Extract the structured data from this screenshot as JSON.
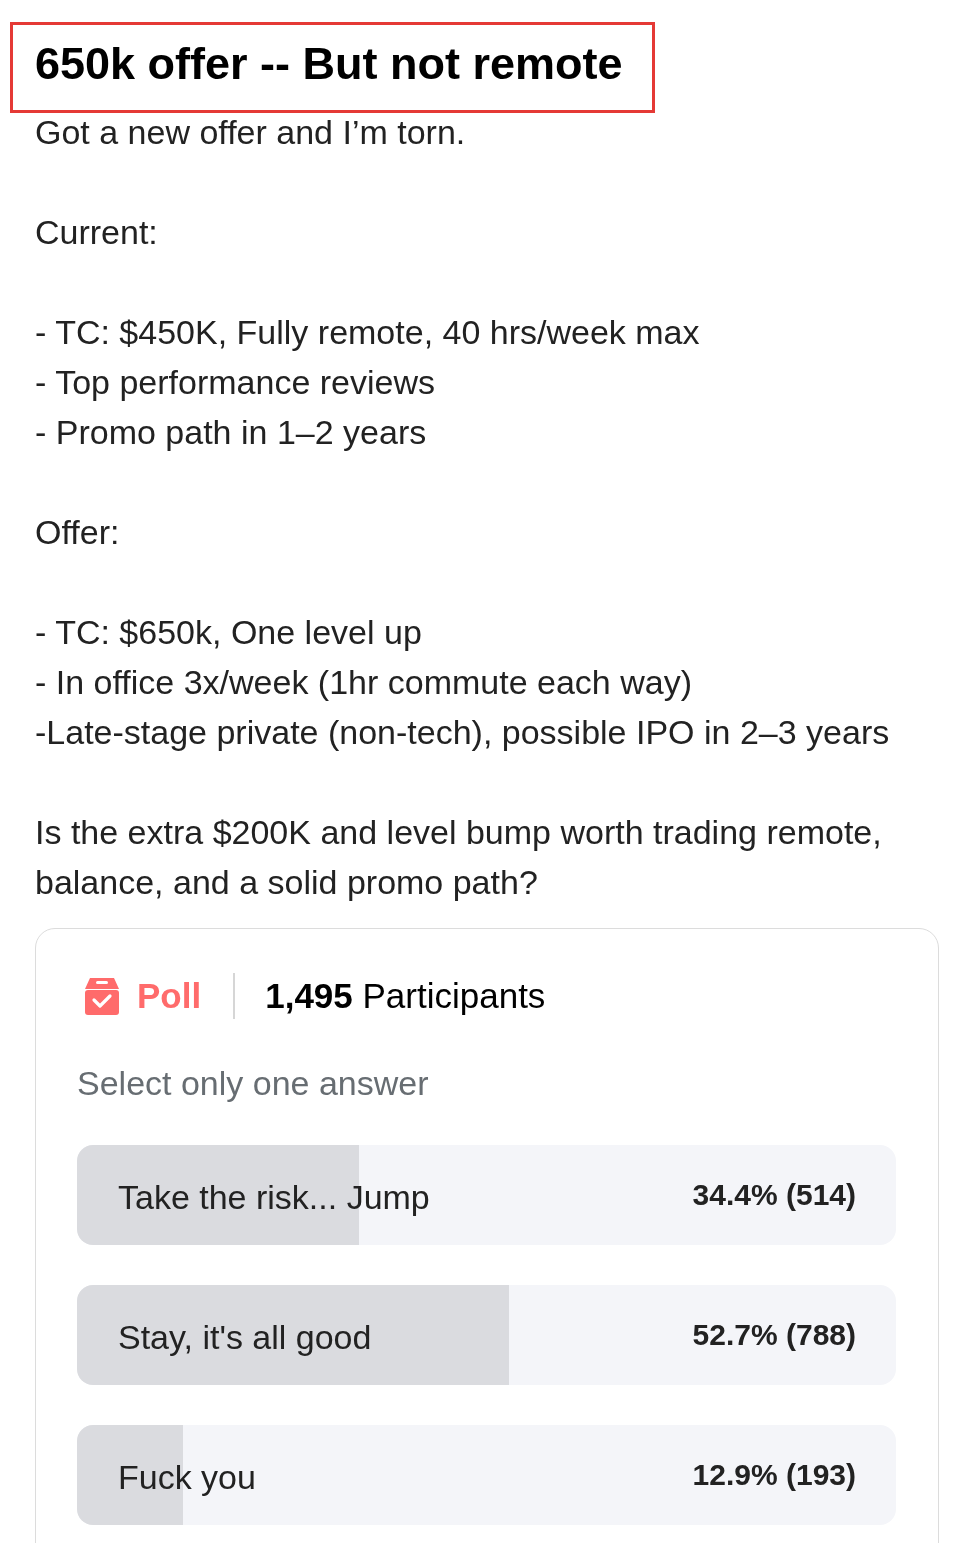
{
  "post": {
    "title": {
      "text": "650k offer -- But not remote",
      "highlighted": true
    },
    "paragraphs": [
      [
        "Got a new offer and I’m torn."
      ],
      [
        "Current:"
      ],
      [
        "- TC: $450K, Fully remote, 40 hrs/week max",
        "- Top performance reviews",
        "- Promo path in 1–2 years"
      ],
      [
        "Offer:"
      ],
      [
        "- TC: $650k, One level up",
        "- In office 3x/week (1hr commute each way)",
        "-Late-stage private (non-tech), possible IPO in 2–3 years"
      ],
      [
        "Is the extra $200K and level bump worth trading remote, balance, and a solid promo path?"
      ]
    ]
  },
  "poll": {
    "label": "Poll",
    "participants": "**1,495** Participants",
    "instruction": "Select only one answer",
    "options": [
      {
        "label": "Take the risk... Jump",
        "result": "34.4% (514)",
        "level": 0.344
      },
      {
        "label": "Stay, it's all good",
        "result": "52.7% (788)",
        "level": 0.527
      },
      {
        "label": "Fuck you",
        "result": "12.9% (193)",
        "level": 0.129
      }
    ]
  }
}
